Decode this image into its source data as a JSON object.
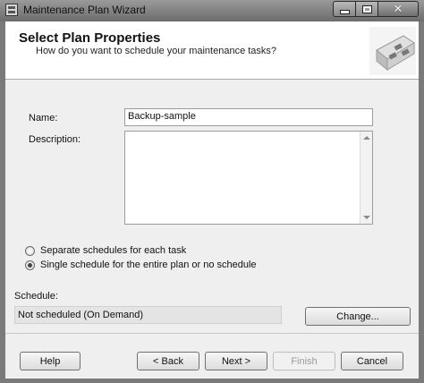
{
  "window": {
    "title": "Maintenance Plan Wizard"
  },
  "window_controls": {
    "minimize_icon": "minimize-icon",
    "maximize_icon": "maximize-icon",
    "close_icon": "close-icon"
  },
  "header": {
    "title": "Select Plan Properties",
    "subtitle": "How do you want to schedule your maintenance tasks?",
    "graphic": "wizard-graphic"
  },
  "form": {
    "name_label": "Name:",
    "name_value": "Backup-sample",
    "description_label": "Description:",
    "description_value": ""
  },
  "schedule_options": {
    "separate_label": "Separate schedules for each task",
    "separate_checked": false,
    "single_label": "Single schedule for the entire plan or no schedule",
    "single_checked": true
  },
  "schedule": {
    "label": "Schedule:",
    "value": "Not scheduled (On Demand)",
    "change_label": "Change..."
  },
  "footer": {
    "help_label": "Help",
    "back_label": "< Back",
    "next_label": "Next >",
    "finish_label": "Finish",
    "cancel_label": "Cancel"
  }
}
